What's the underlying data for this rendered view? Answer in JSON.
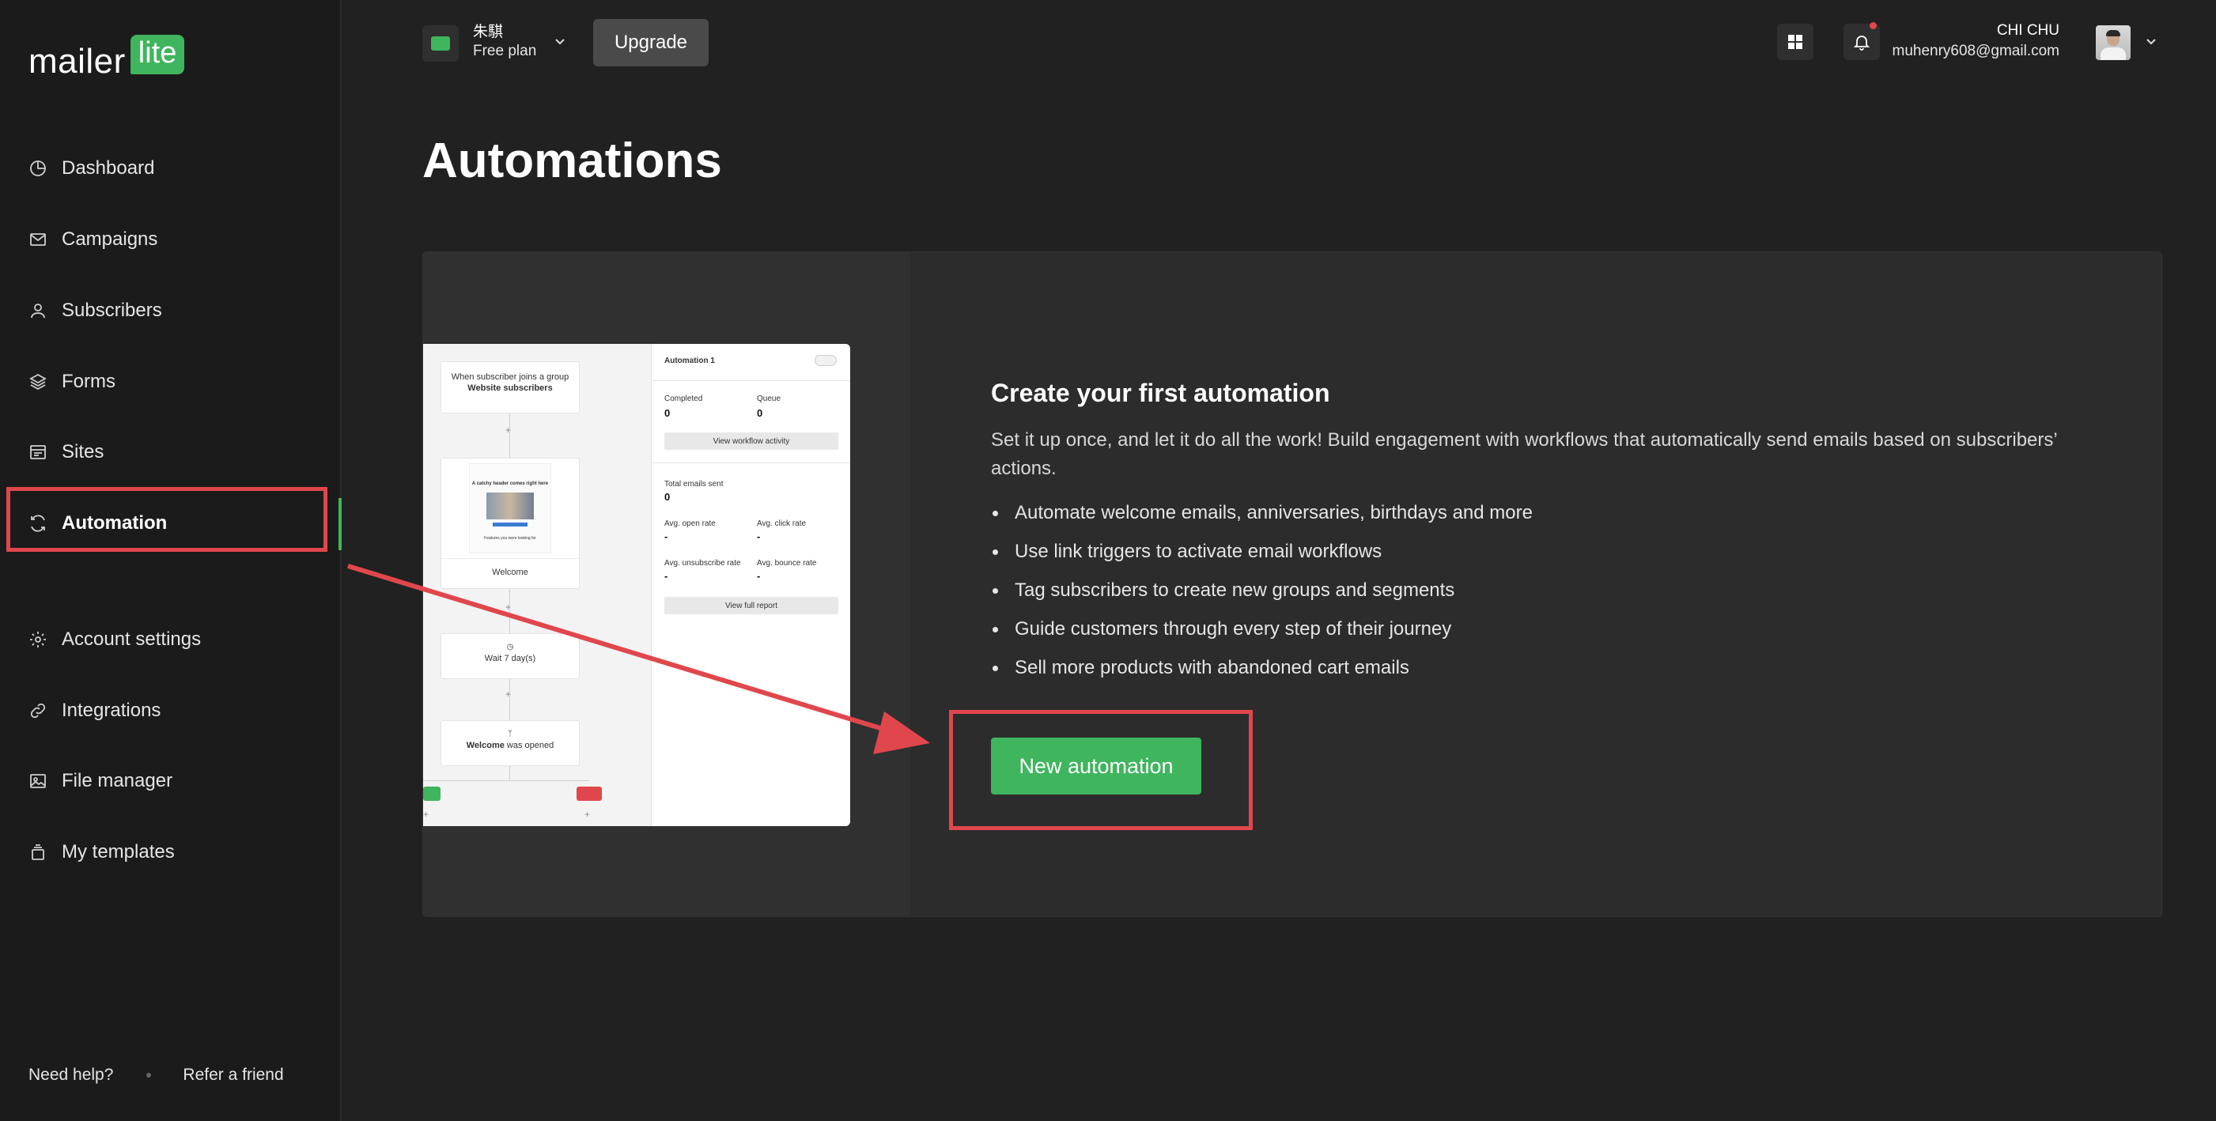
{
  "app": {
    "logo_text": "mailer",
    "logo_badge": "lite"
  },
  "sidebar": {
    "items": [
      {
        "label": "Dashboard",
        "icon": "dashboard-icon"
      },
      {
        "label": "Campaigns",
        "icon": "mail-icon"
      },
      {
        "label": "Subscribers",
        "icon": "user-icon"
      },
      {
        "label": "Forms",
        "icon": "layers-icon"
      },
      {
        "label": "Sites",
        "icon": "sites-icon"
      },
      {
        "label": "Automation",
        "icon": "refresh-icon",
        "active": true
      },
      {
        "label": "Account settings",
        "icon": "gear-icon"
      },
      {
        "label": "Integrations",
        "icon": "link-icon"
      },
      {
        "label": "File manager",
        "icon": "image-icon"
      },
      {
        "label": "My templates",
        "icon": "template-icon"
      }
    ],
    "footer": {
      "help": "Need help?",
      "refer": "Refer a friend"
    }
  },
  "topbar": {
    "workspace_name": "朱騏",
    "workspace_plan": "Free plan",
    "upgrade_label": "Upgrade",
    "user_name": "CHI CHU",
    "user_email": "muhenry608@gmail.com"
  },
  "page": {
    "title": "Automations"
  },
  "card": {
    "title": "Create your first automation",
    "description": "Set it up once, and let it do all the work! Build engagement with workflows that automatically send emails based on subscribers’ actions.",
    "bullets": [
      "Automate welcome emails, anniversaries, birthdays and more",
      "Use link triggers to activate email workflows",
      "Tag subscribers to create new groups and segments",
      "Guide customers through every step of their journey",
      "Sell more products with abandoned cart emails"
    ],
    "cta_label": "New automation"
  },
  "preview": {
    "trigger_text": "When subscriber joins a group",
    "trigger_bold": "Website subscribers",
    "email_headline": "A catchy header comes right here",
    "email_footer": "Features you were looking for",
    "email_node_label": "Welcome",
    "wait_label": "Wait 7 day(s)",
    "condition_bold": "Welcome",
    "condition_rest": "was opened",
    "panel_title": "Automation 1",
    "completed_label": "Completed",
    "completed_value": "0",
    "queue_label": "Queue",
    "queue_value": "0",
    "view_activity": "View workflow activity",
    "total_sent_label": "Total emails sent",
    "total_sent_value": "0",
    "open_rate_label": "Avg. open rate",
    "open_rate_value": "-",
    "click_rate_label": "Avg. click rate",
    "click_rate_value": "-",
    "unsub_rate_label": "Avg. unsubscribe rate",
    "unsub_rate_value": "-",
    "bounce_rate_label": "Avg. bounce rate",
    "bounce_rate_value": "-",
    "view_report": "View full report"
  },
  "colors": {
    "accent": "#3fb55e",
    "highlight": "#e0474c",
    "background": "#212121",
    "sidebar": "#1b1b1b"
  }
}
